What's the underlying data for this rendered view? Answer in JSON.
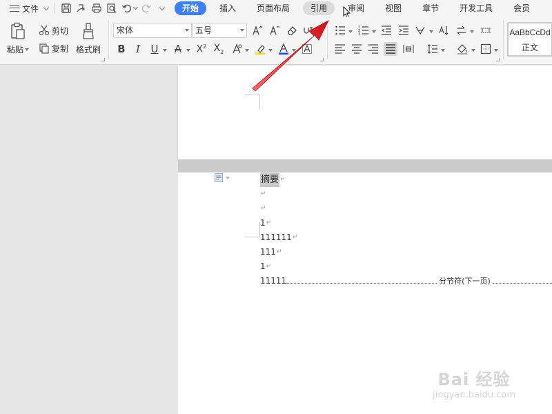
{
  "menubar": {
    "file_label": "文件",
    "tabs": [
      {
        "label": "开始",
        "state": "active"
      },
      {
        "label": "插入",
        "state": ""
      },
      {
        "label": "页面布局",
        "state": ""
      },
      {
        "label": "引用",
        "state": "hover"
      },
      {
        "label": "审阅",
        "state": ""
      },
      {
        "label": "视图",
        "state": ""
      },
      {
        "label": "章节",
        "state": ""
      },
      {
        "label": "开发工具",
        "state": ""
      },
      {
        "label": "会员",
        "state": ""
      }
    ]
  },
  "ribbon": {
    "clipboard": {
      "paste_label": "粘贴",
      "cut_label": "剪切",
      "copy_label": "复制",
      "format_painter_label": "格式刷"
    },
    "font": {
      "font_name": "宋体",
      "font_size": "五号"
    },
    "styles": {
      "sample_text": "AaBbCcDd",
      "style_name": "正文"
    }
  },
  "document": {
    "lines": [
      {
        "text": "摘要",
        "highlight": true
      },
      {
        "text": "",
        "highlight": false
      },
      {
        "text": "",
        "highlight": false
      },
      {
        "text": "1",
        "highlight": false
      },
      {
        "text": "111111",
        "highlight": false
      },
      {
        "text": "111",
        "highlight": false
      },
      {
        "text": "1",
        "highlight": false
      }
    ],
    "last_line_text": "11111",
    "section_break_label": "分节符(下一页)",
    "paragraph_mark": "↵"
  },
  "watermark": {
    "logo_text": "Bai 经验",
    "url_text": "jingyan.baidu.com"
  },
  "colors": {
    "accent": "#3c7ff5",
    "arrow": "#e8262b",
    "highlight": "#c8c8c8"
  }
}
